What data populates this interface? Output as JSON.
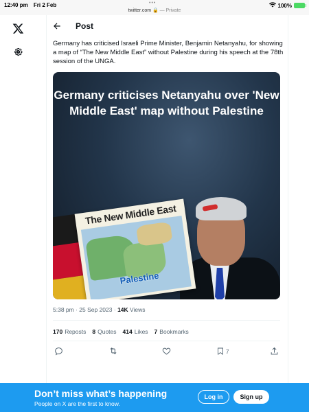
{
  "status_bar": {
    "time": "12:40 pm",
    "date": "Fri 2 Feb",
    "url": "twitter.com",
    "privacy": "— Private",
    "battery": "100%"
  },
  "sidebar": {
    "items": [
      {
        "icon": "x-logo-icon"
      },
      {
        "icon": "settings-gear-icon"
      }
    ]
  },
  "header": {
    "title": "Post"
  },
  "tweet": {
    "text": "Germany has criticised Israeli Prime Minister, Benjamin Netanyahu, for showing a map of “The New Middle East” without Palestine during his speech at the 78th session of the UNGA.",
    "media": {
      "headline": "Germany criticises Netanyahu over 'New Middle East' map without Palestine",
      "map_title": "The New Middle East",
      "map_caption": "Palestine"
    },
    "timestamp": "5:38 pm · 25 Sep 2023",
    "views_count": "14K",
    "views_label": "Views",
    "stats": [
      {
        "count": "170",
        "label": "Reposts"
      },
      {
        "count": "8",
        "label": "Quotes"
      },
      {
        "count": "414",
        "label": "Likes"
      },
      {
        "count": "7",
        "label": "Bookmarks"
      }
    ],
    "actions": {
      "bookmark_count": "7"
    }
  },
  "banner": {
    "title": "Don’t miss what’s happening",
    "subtitle": "People on X are the first to know.",
    "login_label": "Log in",
    "signup_label": "Sign up"
  },
  "colors": {
    "accent": "#1d9bf0",
    "text_primary": "#0f1419",
    "text_secondary": "#536471"
  }
}
